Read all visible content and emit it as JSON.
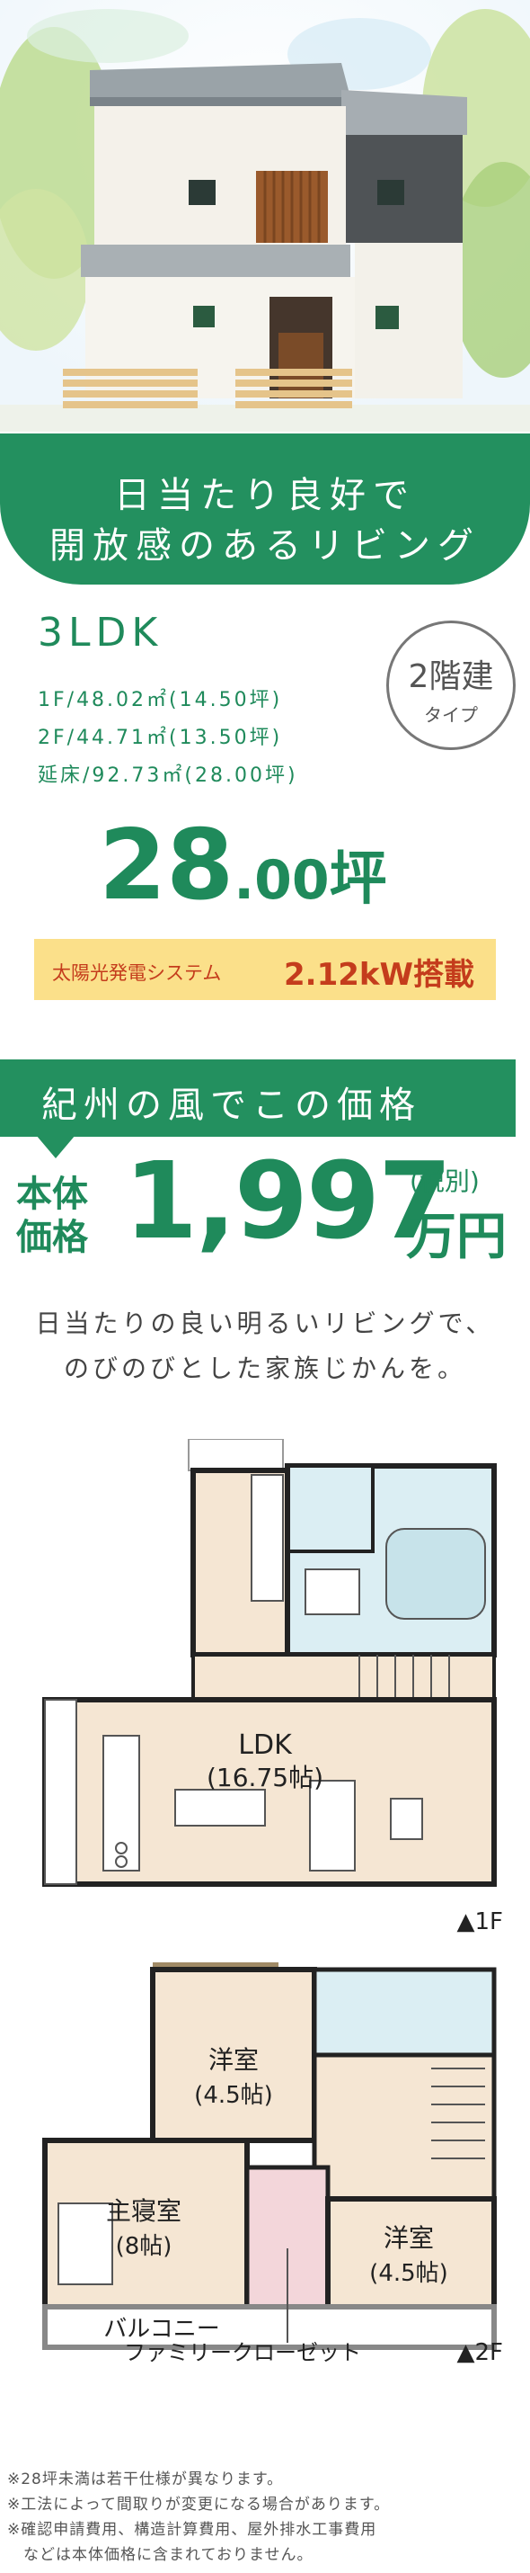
{
  "headline": {
    "line1": "日当たり良好で",
    "line2": "開放感のあるリビング"
  },
  "spec": {
    "layout": "3LDK",
    "floor1": "1F/48.02㎡(14.50坪)",
    "floor2": "2F/44.71㎡(13.50坪)",
    "total": "延床/92.73㎡(28.00坪)",
    "tsubo_int": "28",
    "tsubo_dec": ".00",
    "tsubo_unit": "坪"
  },
  "badge": {
    "line1": "2階建",
    "line2": "タイプ"
  },
  "solar": {
    "label": "太陽光発電システム",
    "value": "2.12kW搭載"
  },
  "price": {
    "banner": "紀州の風でこの価格",
    "label1": "本体",
    "label2": "価格",
    "amount": "1,997",
    "tax": "(税別)",
    "unit": "万円"
  },
  "copy": {
    "line1": "日当たりの良い明るいリビングで、",
    "line2": "のびのびとした家族じかんを。"
  },
  "plan": {
    "ldk_label": "LDK",
    "ldk_size": "(16.75帖)",
    "floor1_label": "▲1F",
    "room_a": "洋室",
    "room_a_size": "(4.5帖)",
    "master": "主寝室",
    "master_size": "(8帖)",
    "room_b": "洋室",
    "room_b_size": "(4.5帖)",
    "balcony": "バルコニー",
    "closet": "ファミリークローゼット",
    "floor2_label": "▲2F"
  },
  "notes": [
    "※28坪未満は若干仕様が異なります。",
    "※工法によって間取りが変更になる場合があります。",
    "※確認申請費用、構造計算費用、屋外排水工事費用",
    "　などは本体価格に含まれておりません。"
  ],
  "colors": {
    "brand_green": "#23905f",
    "solar_bg": "#fbe08a",
    "solar_text": "#c43c1c",
    "floor_tint": "#f5e6d3",
    "wet_tint": "#dbeef3"
  }
}
